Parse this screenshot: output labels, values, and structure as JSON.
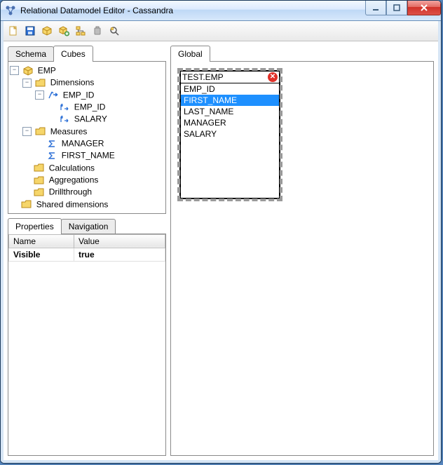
{
  "window": {
    "title": "Relational Datamodel Editor - Cassandra",
    "buttons": {
      "min": "—",
      "max": "▢",
      "close": "X"
    }
  },
  "toolbar": {
    "icons": [
      "new-doc-icon",
      "save-icon",
      "cube-icon",
      "cube-add-icon",
      "schema-icon",
      "undo-node-icon",
      "zoom-icon"
    ]
  },
  "left_tabs": {
    "schema": "Schema",
    "cubes": "Cubes",
    "active": "Cubes"
  },
  "tree": {
    "root": {
      "label": "EMP",
      "children": [
        {
          "label": "Dimensions",
          "children": [
            {
              "label": "EMP_ID",
              "children": [
                {
                  "label": "EMP_ID"
                },
                {
                  "label": "SALARY"
                }
              ]
            }
          ]
        },
        {
          "label": "Measures",
          "children": [
            {
              "label": "MANAGER"
            },
            {
              "label": "FIRST_NAME"
            }
          ]
        },
        {
          "label": "Calculations"
        },
        {
          "label": "Aggregations"
        },
        {
          "label": "Drillthrough"
        }
      ]
    },
    "shared": {
      "label": "Shared dimensions"
    }
  },
  "bottom_tabs": {
    "properties": "Properties",
    "navigation": "Navigation",
    "active": "Properties"
  },
  "properties": {
    "columns": {
      "name": "Name",
      "value": "Value"
    },
    "rows": [
      {
        "name": "Visible",
        "value": "true"
      }
    ]
  },
  "right_tabs": {
    "global": "Global",
    "active": "Global"
  },
  "global_table": {
    "title": "TEST.EMP",
    "fields": [
      "EMP_ID",
      "FIRST_NAME",
      "LAST_NAME",
      "MANAGER",
      "SALARY"
    ],
    "selected": "FIRST_NAME"
  }
}
